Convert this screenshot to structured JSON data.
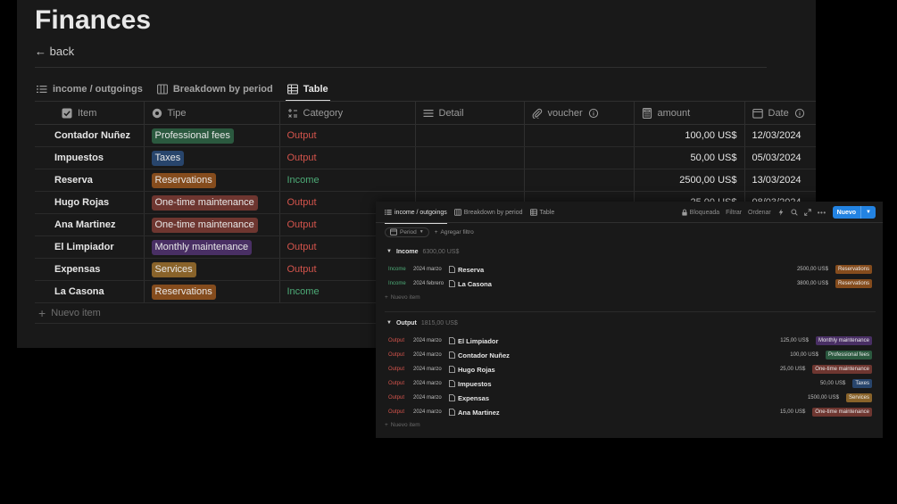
{
  "colors": {
    "professional_fees": "#2b593f",
    "taxes": "#28456c",
    "reservations": "#854c1d",
    "one_time_maintenance": "#6e3630",
    "monthly_maintenance": "#492f64",
    "services": "#89632a",
    "output": "#d4544c",
    "income": "#4dab77",
    "accent": "#2383e2"
  },
  "main": {
    "title": "Finances",
    "back": "← back",
    "tabs": [
      {
        "label": "income / outgoings",
        "icon": "list-icon"
      },
      {
        "label": "Breakdown by period",
        "icon": "board-icon"
      },
      {
        "label": "Table",
        "icon": "table-icon"
      }
    ],
    "columns": {
      "item": "Item",
      "tipe": "Tipe",
      "category": "Category",
      "detail": "Detail",
      "voucher": "voucher",
      "amount": "amount",
      "date": "Date"
    },
    "rows": [
      {
        "item": "Contador Nuñez",
        "tipe": "Professional fees",
        "category": "Output",
        "amount": "100,00 US$",
        "date": "12/03/2024"
      },
      {
        "item": "Impuestos",
        "tipe": "Taxes",
        "category": "Output",
        "amount": "50,00 US$",
        "date": "05/03/2024"
      },
      {
        "item": "Reserva",
        "tipe": "Reservations",
        "category": "Income",
        "amount": "2500,00 US$",
        "date": "13/03/2024"
      },
      {
        "item": "Hugo Rojas",
        "tipe": "One-time maintenance",
        "category": "Output",
        "amount": "25,00 US$",
        "date": "08/03/2024"
      },
      {
        "item": "Ana Martinez",
        "tipe": "One-time maintenance",
        "category": "Output",
        "amount": "",
        "date": ""
      },
      {
        "item": "El Limpiador",
        "tipe": "Monthly maintenance",
        "category": "Output",
        "amount": "",
        "date": ""
      },
      {
        "item": "Expensas",
        "tipe": "Services",
        "category": "Output",
        "amount": "",
        "date": ""
      },
      {
        "item": "La Casona",
        "tipe": "Reservations",
        "category": "Income",
        "amount": "",
        "date": ""
      }
    ],
    "new_item": "Nuevo item"
  },
  "popup": {
    "tabs": [
      {
        "label": "income / outgoings"
      },
      {
        "label": "Breakdown by period"
      },
      {
        "label": "Table"
      }
    ],
    "toolbar": {
      "locked": "Bloqueada",
      "filter": "Filtrar",
      "sort": "Ordenar",
      "new": "Nuevo"
    },
    "filters": {
      "period": "Period",
      "add_filter": "Agregar filtro"
    },
    "groups": [
      {
        "name": "Income",
        "sum": "6300,00 US$",
        "rows": [
          {
            "cat": "Income",
            "date": "2024 marzo",
            "name": "Reserva",
            "amount": "2500,00 US$",
            "tag": "Reservations"
          },
          {
            "cat": "Income",
            "date": "2024 febrero",
            "name": "La Casona",
            "amount": "3800,00 US$",
            "tag": "Reservations"
          }
        ],
        "new_item": "Nuevo item"
      },
      {
        "name": "Output",
        "sum": "1815,00 US$",
        "rows": [
          {
            "cat": "Output",
            "date": "2024 marzo",
            "name": "El Limpiador",
            "amount": "125,00 US$",
            "tag": "Monthly maintenance"
          },
          {
            "cat": "Output",
            "date": "2024 marzo",
            "name": "Contador Nuñez",
            "amount": "100,00 US$",
            "tag": "Professional fees"
          },
          {
            "cat": "Output",
            "date": "2024 marzo",
            "name": "Hugo Rojas",
            "amount": "25,00 US$",
            "tag": "One-time maintenance"
          },
          {
            "cat": "Output",
            "date": "2024 marzo",
            "name": "Impuestos",
            "amount": "50,00 US$",
            "tag": "Taxes"
          },
          {
            "cat": "Output",
            "date": "2024 marzo",
            "name": "Expensas",
            "amount": "1500,00 US$",
            "tag": "Services"
          },
          {
            "cat": "Output",
            "date": "2024 marzo",
            "name": "Ana Martinez",
            "amount": "15,00 US$",
            "tag": "One-time maintenance"
          }
        ],
        "new_item": "Nuevo item"
      }
    ]
  }
}
